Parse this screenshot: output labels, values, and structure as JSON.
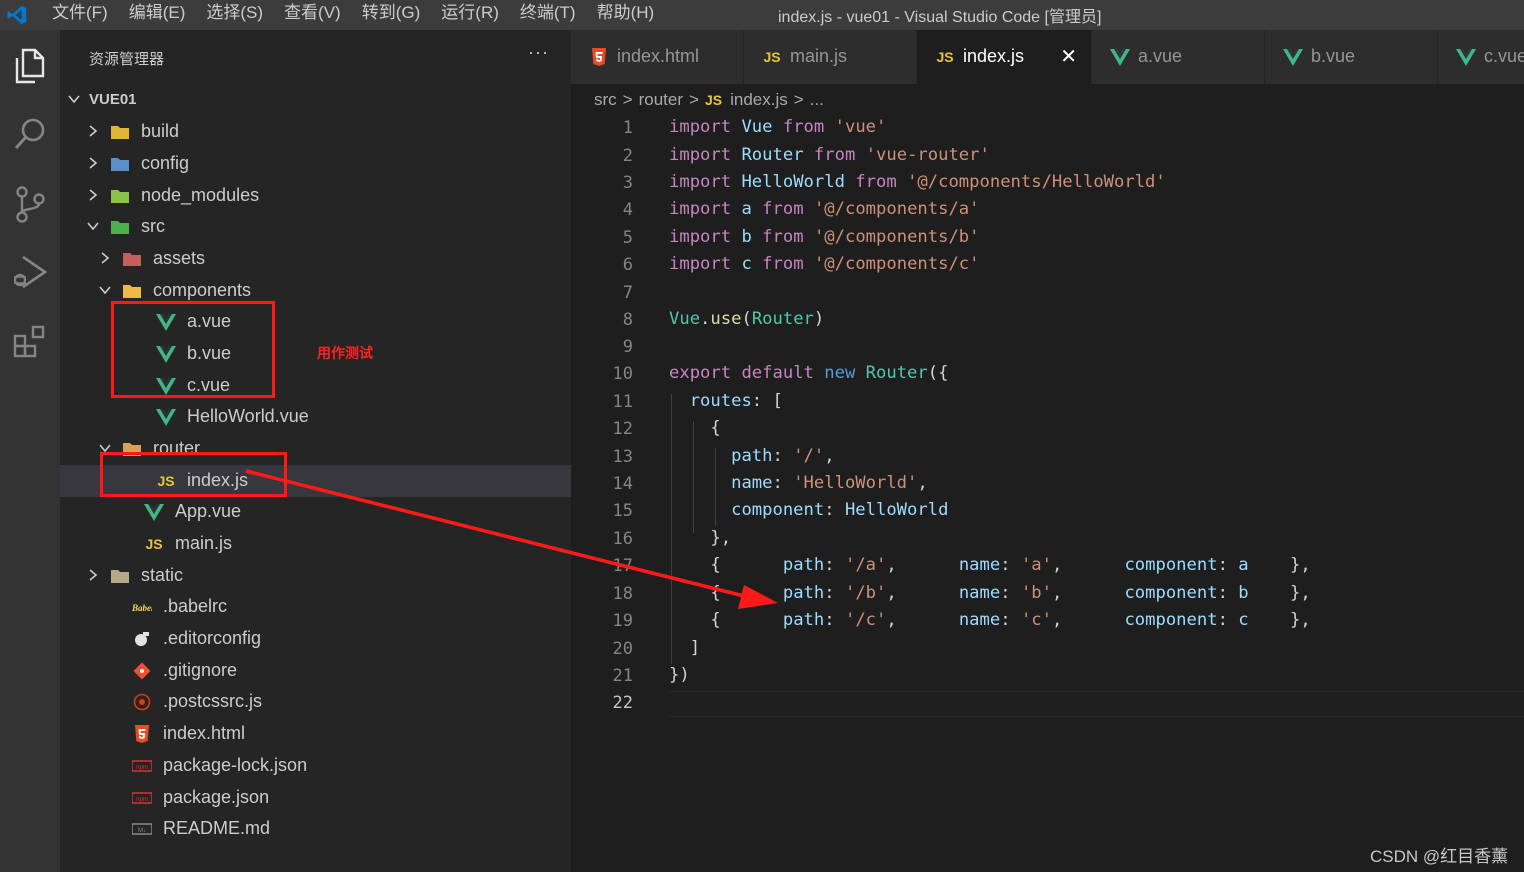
{
  "titlebar": {
    "menu": [
      "文件(F)",
      "编辑(E)",
      "选择(S)",
      "查看(V)",
      "转到(G)",
      "运行(R)",
      "终端(T)",
      "帮助(H)"
    ],
    "window_title": "index.js - vue01 - Visual Studio Code [管理员]"
  },
  "activity_bar": [
    "explorer-icon",
    "search-icon",
    "source-control-icon",
    "run-debug-icon",
    "extensions-icon"
  ],
  "sidebar": {
    "title": "资源管理器",
    "more": "···",
    "root": "VUE01",
    "items": [
      {
        "label": "build",
        "icon": "folder-icon"
      },
      {
        "label": "config",
        "icon": "folder-icon"
      },
      {
        "label": "node_modules",
        "icon": "folder-icon"
      },
      {
        "label": "src",
        "icon": "folder-icon"
      },
      {
        "label": "assets",
        "icon": "folder-icon"
      },
      {
        "label": "components",
        "icon": "folder-icon"
      },
      {
        "label": "a.vue",
        "icon": "vue-icon"
      },
      {
        "label": "b.vue",
        "icon": "vue-icon"
      },
      {
        "label": "c.vue",
        "icon": "vue-icon"
      },
      {
        "label": "HelloWorld.vue",
        "icon": "vue-icon"
      },
      {
        "label": "router",
        "icon": "folder-icon"
      },
      {
        "label": "index.js",
        "icon": "js-icon"
      },
      {
        "label": "App.vue",
        "icon": "vue-icon"
      },
      {
        "label": "main.js",
        "icon": "js-icon"
      },
      {
        "label": "static",
        "icon": "folder-icon"
      },
      {
        "label": ".babelrc",
        "icon": "babel-icon"
      },
      {
        "label": ".editorconfig",
        "icon": "editorconfig-icon"
      },
      {
        "label": ".gitignore",
        "icon": "git-icon"
      },
      {
        "label": ".postcssrc.js",
        "icon": "postcss-icon"
      },
      {
        "label": "index.html",
        "icon": "html-icon"
      },
      {
        "label": "package-lock.json",
        "icon": "npm-icon"
      },
      {
        "label": "package.json",
        "icon": "npm-icon"
      },
      {
        "label": "README.md",
        "icon": "markdown-icon"
      }
    ]
  },
  "tabs": [
    {
      "label": "index.html",
      "icon": "html-icon"
    },
    {
      "label": "main.js",
      "icon": "js-icon"
    },
    {
      "label": "index.js",
      "icon": "js-icon",
      "active": true
    },
    {
      "label": "a.vue",
      "icon": "vue-icon"
    },
    {
      "label": "b.vue",
      "icon": "vue-icon"
    },
    {
      "label": "c.vue",
      "icon": "vue-icon"
    }
  ],
  "js_label": "JS",
  "close_glyph": "✕",
  "breadcrumb": {
    "parts": [
      "src",
      "router",
      "index.js",
      "..."
    ],
    "sep": ">"
  },
  "editor": {
    "line_numbers": [
      "1",
      "2",
      "3",
      "4",
      "5",
      "6",
      "7",
      "8",
      "9",
      "10",
      "11",
      "12",
      "13",
      "14",
      "15",
      "16",
      "17",
      "18",
      "19",
      "20",
      "21",
      "22"
    ],
    "current_line": "22"
  },
  "annotations": {
    "note": "用作测试",
    "watermark": "CSDN @红目香薰"
  },
  "colors": {
    "annotation_red": "#ff1a1a",
    "vue_green": "#41b883",
    "js_yellow": "#e8c43c",
    "html_orange": "#e44d26"
  }
}
